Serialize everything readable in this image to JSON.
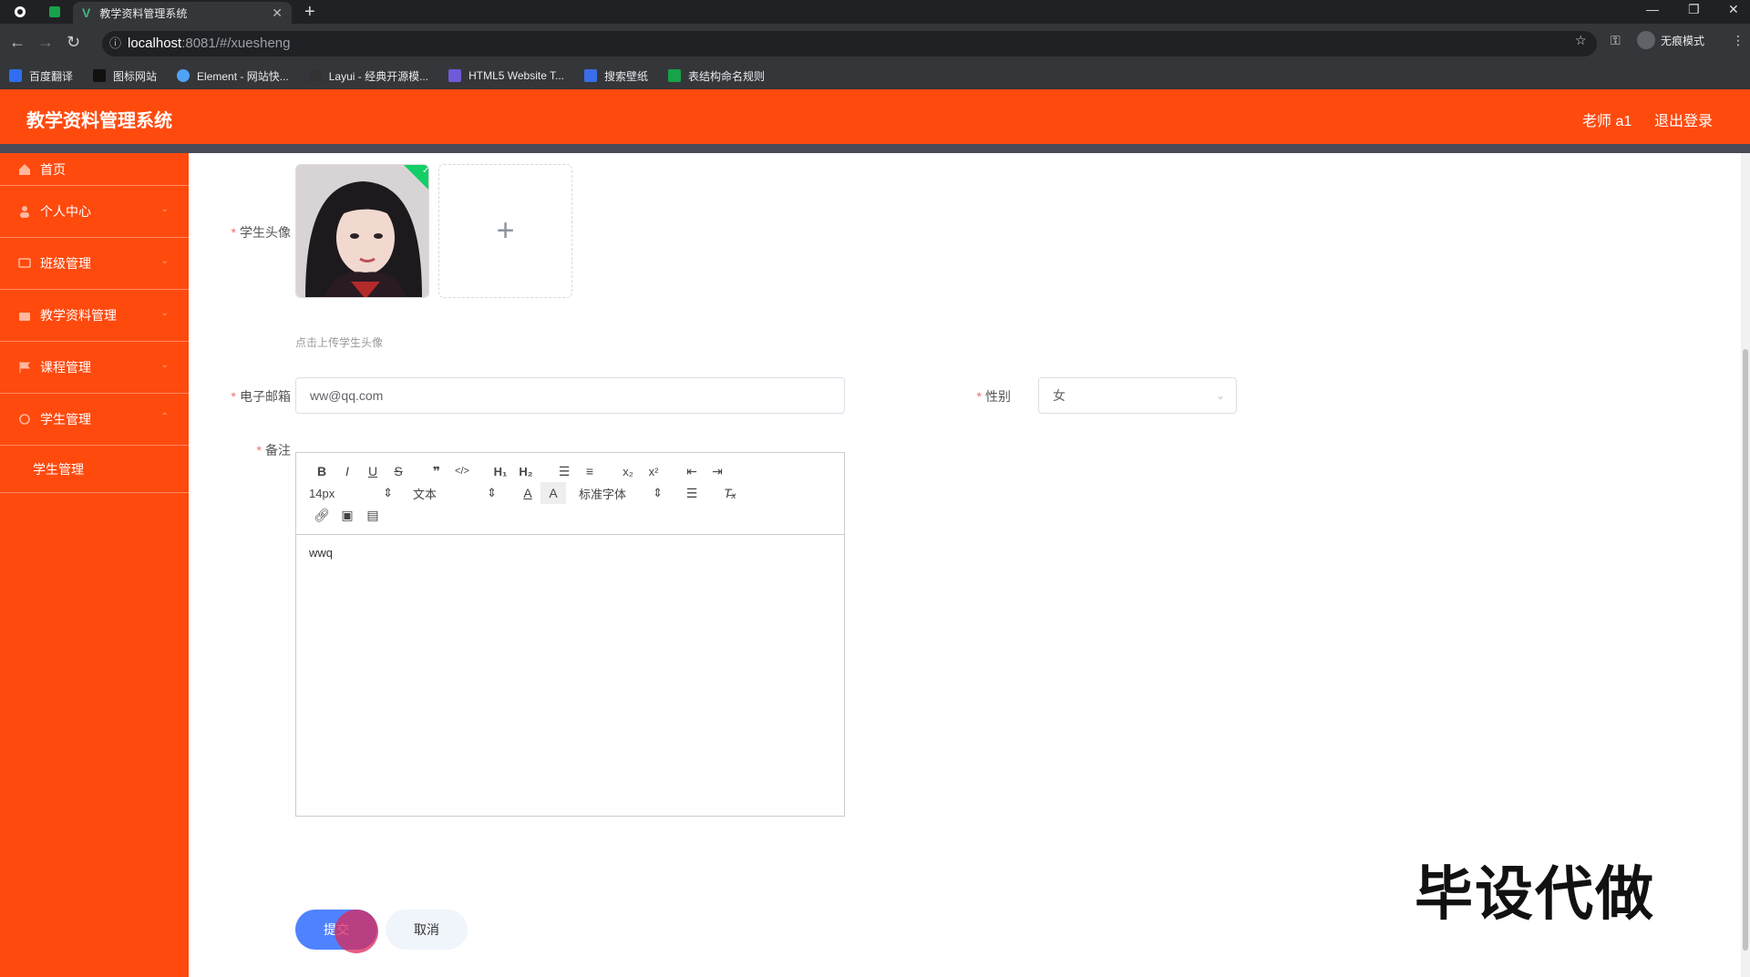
{
  "browser": {
    "tab_title": "教学资料管理系统",
    "url_host": "localhost",
    "url_path": ":8081/#/xuesheng",
    "incognito_label": "无痕模式",
    "bookmarks": [
      {
        "label": "百度翻译",
        "color": "#2f6ef0"
      },
      {
        "label": "图标网站",
        "color": "#111111"
      },
      {
        "label": "Element - 网站快...",
        "color": "#4fa3f7"
      },
      {
        "label": "Layui - 经典开源模...",
        "color": "#333333"
      },
      {
        "label": "HTML5 Website T...",
        "color": "#6f5bd8"
      },
      {
        "label": "搜索壁纸",
        "color": "#3a6ee8"
      },
      {
        "label": "表结构命名规则",
        "color": "#17a34a"
      }
    ]
  },
  "header": {
    "title": "教学资料管理系统",
    "user": "老师 a1",
    "logout": "退出登录"
  },
  "sidebar": {
    "items": [
      {
        "label": "首页"
      },
      {
        "label": "个人中心"
      },
      {
        "label": "班级管理"
      },
      {
        "label": "教学资料管理"
      },
      {
        "label": "课程管理"
      },
      {
        "label": "学生管理"
      }
    ],
    "submenu_label": "学生管理"
  },
  "form": {
    "avatar_label": "学生头像",
    "upload_hint": "点击上传学生头像",
    "email_label": "电子邮箱",
    "email_value": "ww@qq.com",
    "gender_label": "性别",
    "gender_value": "女",
    "remark_label": "备注",
    "editor": {
      "font_size": "14px",
      "header_select": "文本",
      "font_family": "标准字体",
      "content": "wwq"
    },
    "submit_label": "提交",
    "cancel_label": "取消"
  },
  "watermark": "毕设代做",
  "colors": {
    "brand": "#ff4a0e",
    "submit": "#4f82ff",
    "required": "#f56c6c"
  }
}
